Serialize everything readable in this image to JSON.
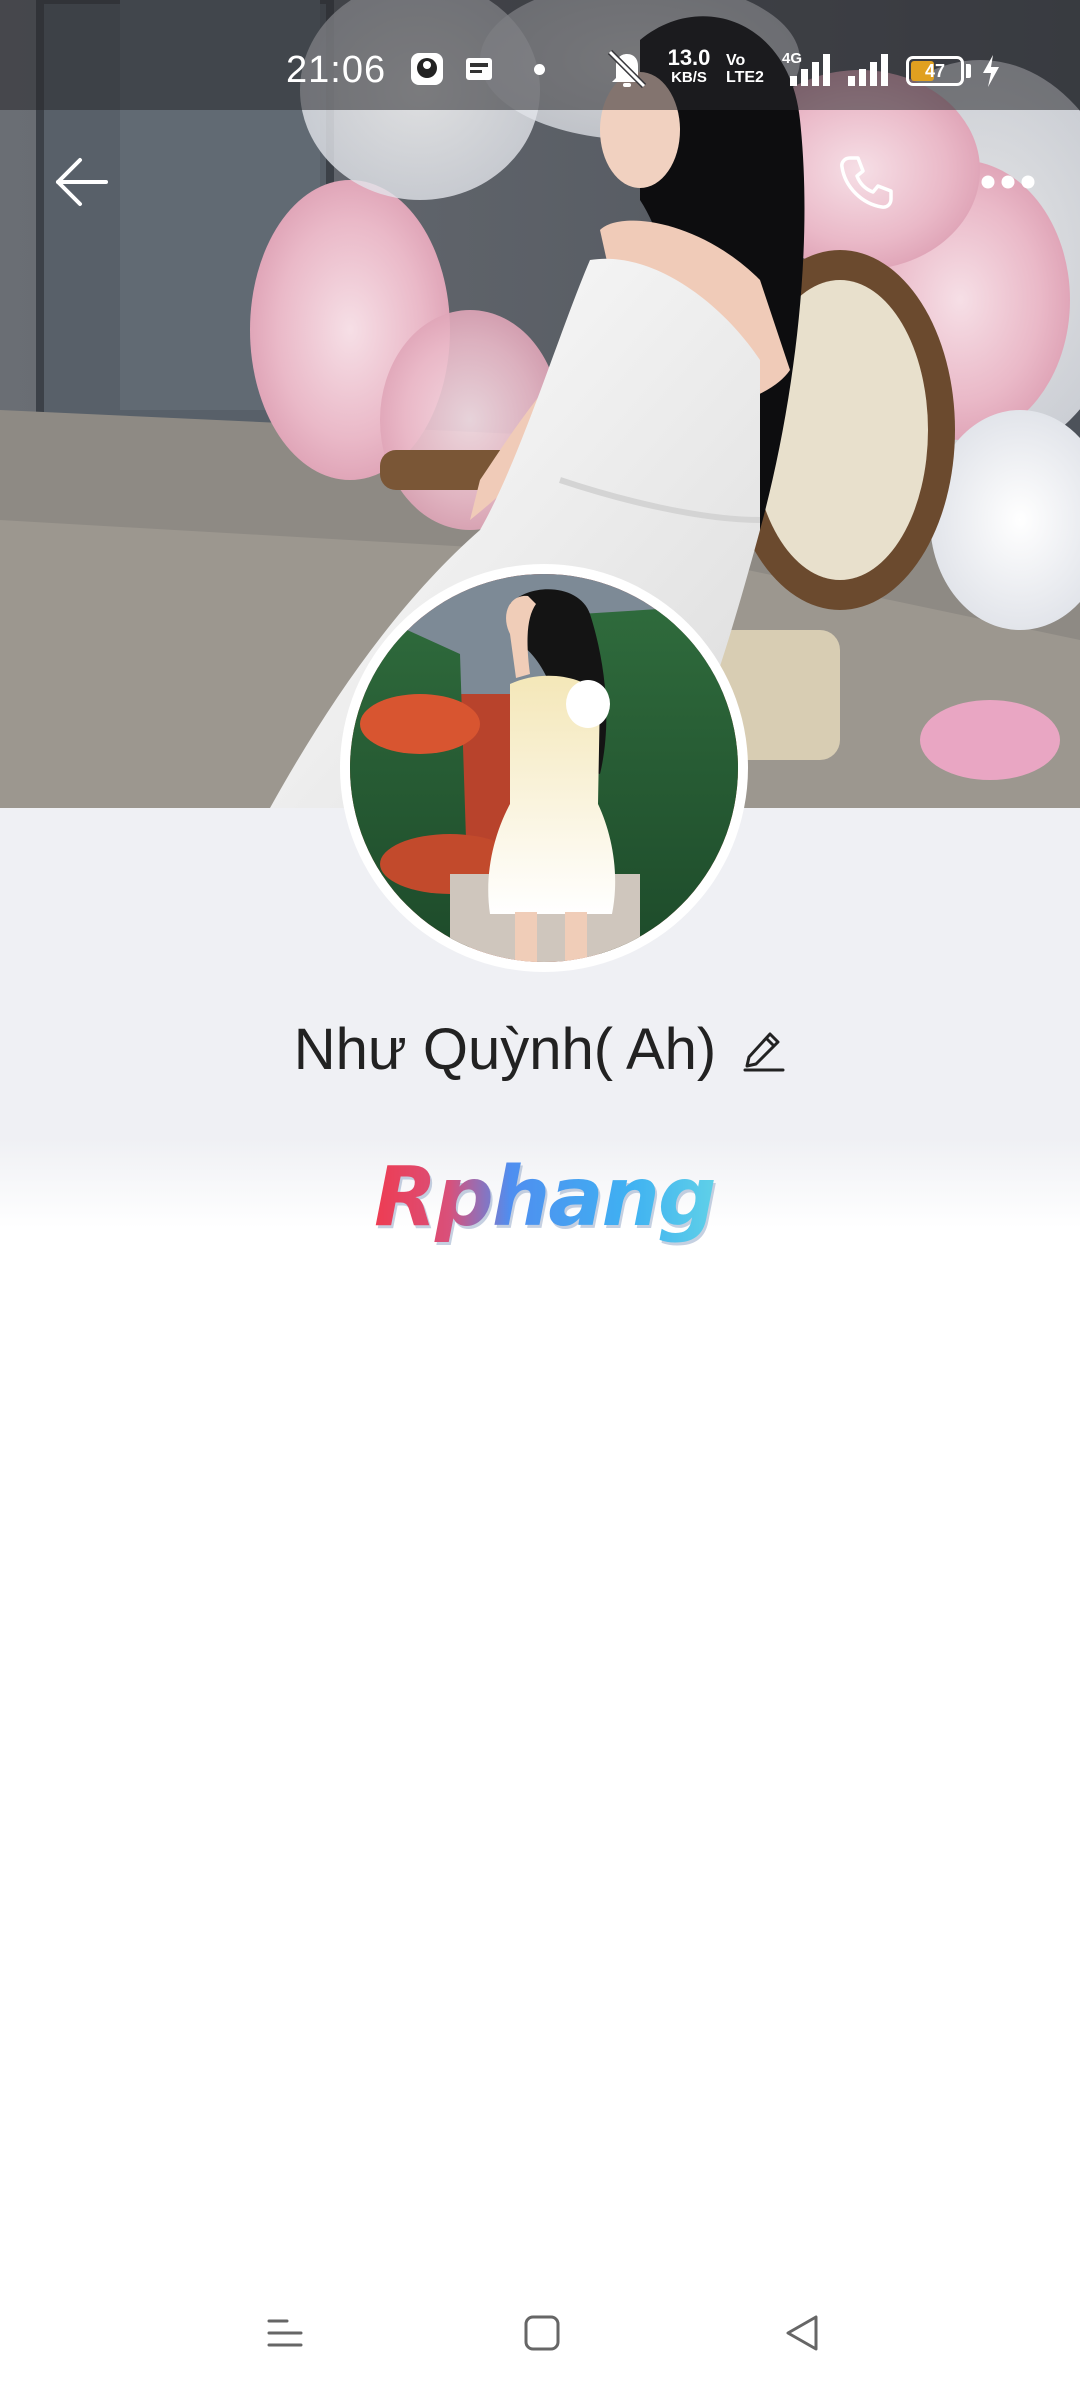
{
  "status_bar": {
    "time": "21:06",
    "net_speed_value": "13.0",
    "net_speed_unit": "KB/S",
    "volte_top": "Vo",
    "volte_bottom": "LTE2",
    "network_type": "4G",
    "battery_percent": "47",
    "battery_level": 0.47,
    "battery_fill_color": "#e0a020",
    "icons": [
      "app-notification-icon",
      "app-notification-icon",
      "dot-icon",
      "muted-bell-icon",
      "signal-icon",
      "signal-icon",
      "battery-icon",
      "charging-icon"
    ]
  },
  "header": {
    "icons": [
      "back-arrow-icon",
      "phone-call-icon",
      "more-options-icon"
    ]
  },
  "profile": {
    "name": "Như Quỳnh( Ah)",
    "edit_icon": "pencil-icon"
  },
  "watermark": {
    "text": "Rphang"
  },
  "nav_bar": {
    "icons": [
      "recent-apps-icon",
      "home-icon",
      "back-triangle-icon"
    ]
  },
  "colors": {
    "profile_bg": "#eff0f4",
    "name_text": "#222222",
    "icon_white": "#ffffff",
    "nav_icon": "#666666"
  }
}
